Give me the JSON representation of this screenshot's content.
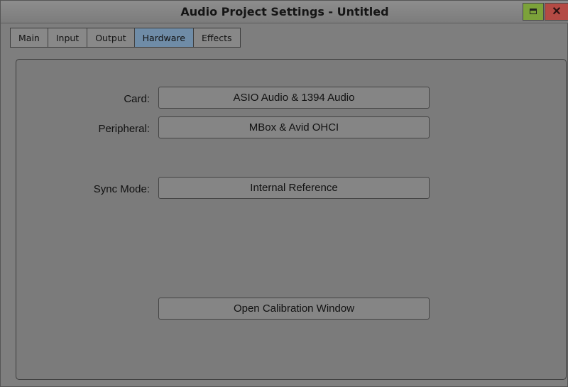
{
  "window": {
    "title": "Audio Project Settings - Untitled",
    "maximize_icon": "maximize-icon",
    "close_icon": "close-icon",
    "close_glyph": "✕",
    "colors": {
      "maximize": "#7ca23a",
      "close": "#b44a44",
      "active_tab": "#6f8ca7"
    }
  },
  "tabs": [
    {
      "label": "Main"
    },
    {
      "label": "Input"
    },
    {
      "label": "Output"
    },
    {
      "label": "Hardware",
      "active": true
    },
    {
      "label": "Effects"
    }
  ],
  "settings": {
    "card": {
      "label": "Card:",
      "value": "ASIO Audio & 1394 Audio"
    },
    "peripheral": {
      "label": "Peripheral:",
      "value": "MBox & Avid OHCI"
    },
    "sync_mode": {
      "label": "Sync Mode:",
      "value": "Internal Reference"
    }
  },
  "actions": {
    "calibration_label": "Open Calibration Window"
  }
}
